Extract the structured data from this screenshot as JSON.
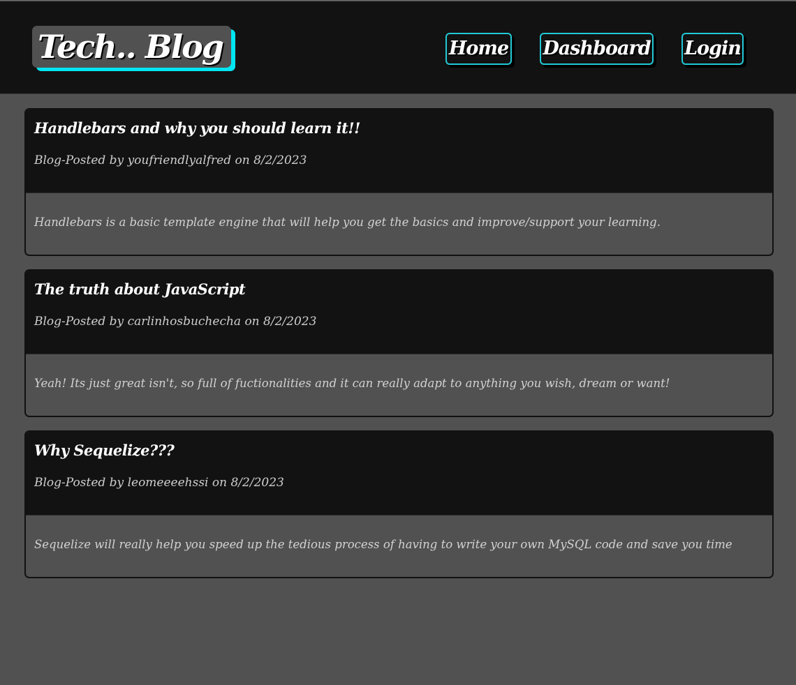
{
  "header": {
    "logo": "Tech.. Blog",
    "nav": [
      {
        "label": "Home"
      },
      {
        "label": "Dashboard"
      },
      {
        "label": "Login"
      }
    ]
  },
  "posts": [
    {
      "title": "Handlebars and why you should learn it!!",
      "meta": "Blog-Posted by youfriendlyalfred on 8/2/2023",
      "body": "Handlebars is a basic template engine that will help you get the basics and improve/support your learning."
    },
    {
      "title": "The truth about JavaScript",
      "meta": "Blog-Posted by carlinhosbuchecha on 8/2/2023",
      "body": "Yeah! Its just great isn't, so full of fuctionalities and it can really adapt to anything you wish, dream or want!"
    },
    {
      "title": "Why Sequelize???",
      "meta": "Blog-Posted by leomeeeehssi on 8/2/2023",
      "body": "Sequelize will really help you speed up the tedious process of having to write your own MySQL code and save you time"
    }
  ]
}
